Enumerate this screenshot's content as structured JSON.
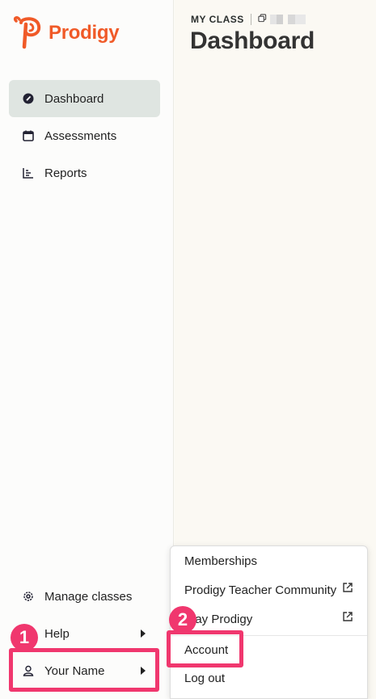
{
  "brand": {
    "name": "Prodigy",
    "color": "#f05a28"
  },
  "header": {
    "class_label": "MY CLASS",
    "title": "Dashboard"
  },
  "sidebar": {
    "items": [
      {
        "label": "Dashboard",
        "icon": "dashboard-icon",
        "active": true
      },
      {
        "label": "Assessments",
        "icon": "calendar-icon"
      },
      {
        "label": "Reports",
        "icon": "bar-chart-icon"
      }
    ],
    "bottom": [
      {
        "label": "Manage classes",
        "icon": "gear-icon"
      },
      {
        "label": "Help",
        "icon": "none"
      },
      {
        "label": "Your Name",
        "icon": "user-icon"
      }
    ]
  },
  "menu": {
    "items": [
      {
        "label": "Memberships"
      },
      {
        "label": "Prodigy Teacher Community",
        "external": true
      },
      {
        "label": "Play Prodigy",
        "external": true
      },
      {
        "label": "Account"
      },
      {
        "label": "Log out"
      }
    ]
  },
  "annotations": {
    "step1": "1",
    "step2": "2",
    "accent": "#f0376e"
  }
}
